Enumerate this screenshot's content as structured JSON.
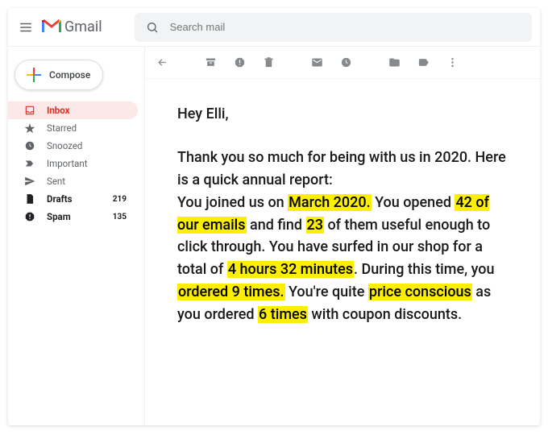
{
  "header": {
    "brand": "Gmail",
    "search_placeholder": "Search mail"
  },
  "compose": {
    "label": "Compose"
  },
  "folders": [
    {
      "key": "inbox",
      "label": "Inbox",
      "count": "",
      "active": true,
      "bold": false,
      "icon": "inbox-icon"
    },
    {
      "key": "starred",
      "label": "Starred",
      "count": "",
      "active": false,
      "bold": false,
      "icon": "star-icon"
    },
    {
      "key": "snoozed",
      "label": "Snoozed",
      "count": "",
      "active": false,
      "bold": false,
      "icon": "clock-icon"
    },
    {
      "key": "important",
      "label": "Important",
      "count": "",
      "active": false,
      "bold": false,
      "icon": "important-icon"
    },
    {
      "key": "sent",
      "label": "Sent",
      "count": "",
      "active": false,
      "bold": false,
      "icon": "sent-icon"
    },
    {
      "key": "drafts",
      "label": "Drafts",
      "count": "219",
      "active": false,
      "bold": true,
      "icon": "file-icon"
    },
    {
      "key": "spam",
      "label": "Spam",
      "count": "135",
      "active": false,
      "bold": true,
      "icon": "spam-icon"
    }
  ],
  "email": {
    "greeting": "Hey Elli,",
    "p_intro1": "Thank you so much for being with us in 2020. Here is a quick annual report:",
    "p_join_pre": "You joined us on ",
    "hl_join": "March 2020.",
    "p_join_post": " You opened ",
    "hl_opened": "42 of our emails",
    "p_opened_post": " and find ",
    "hl_useful": "23",
    "p_useful_post": " of them useful enough to click through. You have surfed in our shop for a total of ",
    "hl_time": "4 hours 32 minutes",
    "p_time_post": ". During this time, you ",
    "hl_orders": "ordered 9 times.",
    "p_orders_post": " You're quite ",
    "hl_price": "price conscious",
    "p_price_post": " as you ordered ",
    "hl_coupon": "6 times",
    "p_coupon_post": " with coupon discounts."
  }
}
